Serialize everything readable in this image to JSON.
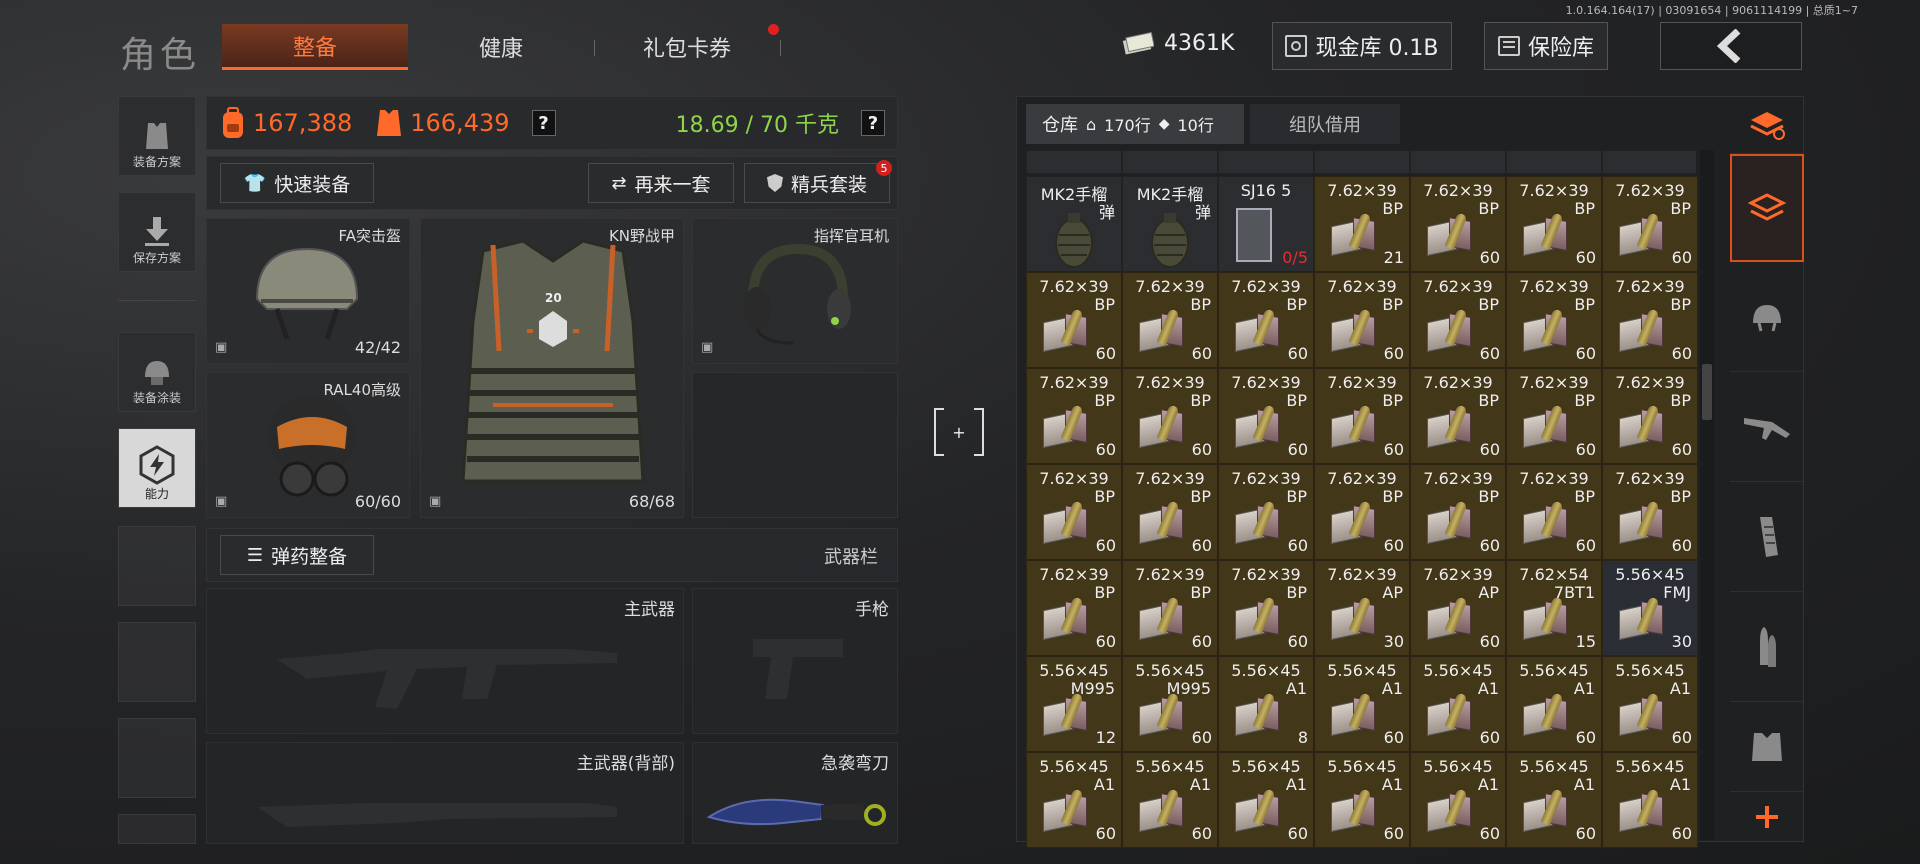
{
  "version": "1.0.164.164(17) | 03091654 | 9061114199 | 总质1~7",
  "header": {
    "title": "角色",
    "tabs": [
      {
        "label": "整备",
        "active": true
      },
      {
        "label": "健康",
        "active": false
      },
      {
        "label": "礼包卡券",
        "active": false,
        "badge": true
      }
    ],
    "currency": "4361K",
    "cash_vault": "现金库 0.1B",
    "safe_box": "保险库"
  },
  "left_menu": [
    {
      "label": "装备方案",
      "icon": "vest-icon"
    },
    {
      "label": "保存方案",
      "icon": "download-icon"
    },
    {
      "label": "装备涂装",
      "icon": "helmet-paint-icon"
    },
    {
      "label": "能力",
      "icon": "ability-icon",
      "active": true
    }
  ],
  "stats": {
    "backpack_value": "167,388",
    "equipment_value": "166,439",
    "weight": "18.69 / 70 千克"
  },
  "actions": {
    "quick_equip": "快速装备",
    "again": "再来一套",
    "elite_set": "精兵套装",
    "elite_badge": "5",
    "ammo_equip": "弹药整备",
    "weapon_bar": "武器栏"
  },
  "gear": {
    "helmet": {
      "name": "FA突击盔",
      "durability": "42/42"
    },
    "mask": {
      "name": "RAL40高级",
      "durability": "60/60"
    },
    "armor": {
      "name": "KN野战甲",
      "durability": "68/68",
      "number": "20"
    },
    "headset": {
      "name": "指挥官耳机"
    }
  },
  "weapons": {
    "primary": "主武器",
    "pistol": "手枪",
    "primary_back": "主武器(背部)",
    "melee": "急袭弯刀"
  },
  "warehouse": {
    "tab_label": "仓库",
    "rows": "170行",
    "tag_rows": "10行",
    "team_borrow": "组队借用",
    "grid": [
      [
        {
          "cal": "MK2手榴",
          "typ": "弹",
          "cnt": "",
          "kind": "grenade"
        },
        {
          "cal": "MK2手榴",
          "typ": "弹",
          "cnt": "",
          "kind": "grenade"
        },
        {
          "cal": "SJ16 5",
          "typ": "",
          "cnt": "0/5",
          "kind": "case"
        },
        {
          "cal": "7.62×39",
          "typ": "BP",
          "cnt": "21",
          "kind": "ammo"
        },
        {
          "cal": "7.62×39",
          "typ": "BP",
          "cnt": "60",
          "kind": "ammo"
        },
        {
          "cal": "7.62×39",
          "typ": "BP",
          "cnt": "60",
          "kind": "ammo"
        },
        {
          "cal": "7.62×39",
          "typ": "BP",
          "cnt": "60",
          "kind": "ammo"
        }
      ],
      [
        {
          "cal": "7.62×39",
          "typ": "BP",
          "cnt": "60",
          "kind": "ammo"
        },
        {
          "cal": "7.62×39",
          "typ": "BP",
          "cnt": "60",
          "kind": "ammo"
        },
        {
          "cal": "7.62×39",
          "typ": "BP",
          "cnt": "60",
          "kind": "ammo"
        },
        {
          "cal": "7.62×39",
          "typ": "BP",
          "cnt": "60",
          "kind": "ammo"
        },
        {
          "cal": "7.62×39",
          "typ": "BP",
          "cnt": "60",
          "kind": "ammo"
        },
        {
          "cal": "7.62×39",
          "typ": "BP",
          "cnt": "60",
          "kind": "ammo"
        },
        {
          "cal": "7.62×39",
          "typ": "BP",
          "cnt": "60",
          "kind": "ammo"
        }
      ],
      [
        {
          "cal": "7.62×39",
          "typ": "BP",
          "cnt": "60",
          "kind": "ammo"
        },
        {
          "cal": "7.62×39",
          "typ": "BP",
          "cnt": "60",
          "kind": "ammo"
        },
        {
          "cal": "7.62×39",
          "typ": "BP",
          "cnt": "60",
          "kind": "ammo"
        },
        {
          "cal": "7.62×39",
          "typ": "BP",
          "cnt": "60",
          "kind": "ammo"
        },
        {
          "cal": "7.62×39",
          "typ": "BP",
          "cnt": "60",
          "kind": "ammo"
        },
        {
          "cal": "7.62×39",
          "typ": "BP",
          "cnt": "60",
          "kind": "ammo"
        },
        {
          "cal": "7.62×39",
          "typ": "BP",
          "cnt": "60",
          "kind": "ammo"
        }
      ],
      [
        {
          "cal": "7.62×39",
          "typ": "BP",
          "cnt": "60",
          "kind": "ammo"
        },
        {
          "cal": "7.62×39",
          "typ": "BP",
          "cnt": "60",
          "kind": "ammo"
        },
        {
          "cal": "7.62×39",
          "typ": "BP",
          "cnt": "60",
          "kind": "ammo"
        },
        {
          "cal": "7.62×39",
          "typ": "BP",
          "cnt": "60",
          "kind": "ammo"
        },
        {
          "cal": "7.62×39",
          "typ": "BP",
          "cnt": "60",
          "kind": "ammo"
        },
        {
          "cal": "7.62×39",
          "typ": "BP",
          "cnt": "60",
          "kind": "ammo"
        },
        {
          "cal": "7.62×39",
          "typ": "BP",
          "cnt": "60",
          "kind": "ammo"
        }
      ],
      [
        {
          "cal": "7.62×39",
          "typ": "BP",
          "cnt": "60",
          "kind": "ammo"
        },
        {
          "cal": "7.62×39",
          "typ": "BP",
          "cnt": "60",
          "kind": "ammo"
        },
        {
          "cal": "7.62×39",
          "typ": "BP",
          "cnt": "60",
          "kind": "ammo"
        },
        {
          "cal": "7.62×39",
          "typ": "AP",
          "cnt": "30",
          "kind": "ammo"
        },
        {
          "cal": "7.62×39",
          "typ": "AP",
          "cnt": "60",
          "kind": "ammo"
        },
        {
          "cal": "7.62×54",
          "typ": "7BT1",
          "cnt": "15",
          "kind": "ammo"
        },
        {
          "cal": "5.56×45",
          "typ": "FMJ",
          "cnt": "30",
          "kind": "ammo",
          "sel": true
        }
      ],
      [
        {
          "cal": "5.56×45",
          "typ": "M995",
          "cnt": "12",
          "kind": "ammo"
        },
        {
          "cal": "5.56×45",
          "typ": "M995",
          "cnt": "60",
          "kind": "ammo"
        },
        {
          "cal": "5.56×45",
          "typ": "A1",
          "cnt": "8",
          "kind": "ammo"
        },
        {
          "cal": "5.56×45",
          "typ": "A1",
          "cnt": "60",
          "kind": "ammo"
        },
        {
          "cal": "5.56×45",
          "typ": "A1",
          "cnt": "60",
          "kind": "ammo"
        },
        {
          "cal": "5.56×45",
          "typ": "A1",
          "cnt": "60",
          "kind": "ammo"
        },
        {
          "cal": "5.56×45",
          "typ": "A1",
          "cnt": "60",
          "kind": "ammo"
        }
      ],
      [
        {
          "cal": "5.56×45",
          "typ": "A1",
          "cnt": "60",
          "kind": "ammo"
        },
        {
          "cal": "5.56×45",
          "typ": "A1",
          "cnt": "60",
          "kind": "ammo"
        },
        {
          "cal": "5.56×45",
          "typ": "A1",
          "cnt": "60",
          "kind": "ammo"
        },
        {
          "cal": "5.56×45",
          "typ": "A1",
          "cnt": "60",
          "kind": "ammo"
        },
        {
          "cal": "5.56×45",
          "typ": "A1",
          "cnt": "60",
          "kind": "ammo"
        },
        {
          "cal": "5.56×45",
          "typ": "A1",
          "cnt": "60",
          "kind": "ammo"
        },
        {
          "cal": "5.56×45",
          "typ": "A1",
          "cnt": "60",
          "kind": "ammo"
        }
      ]
    ]
  },
  "filters": [
    "all-filter-icon",
    "stack-filter-icon",
    "helmet-filter-icon",
    "rifle-filter-icon",
    "magazine-filter-icon",
    "bullet-filter-icon",
    "armor-filter-icon",
    "add-icon"
  ],
  "colors": {
    "accent": "#ff6a2a",
    "weight": "#8fd44a",
    "ammo_cell": "#423718"
  }
}
